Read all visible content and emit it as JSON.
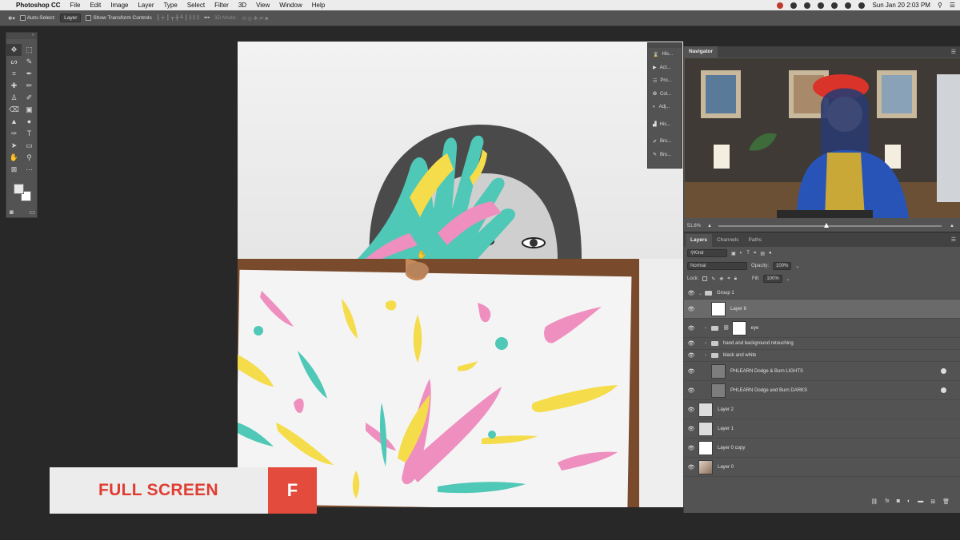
{
  "menubar": {
    "app_name": "Photoshop CC",
    "items": [
      "File",
      "Edit",
      "Image",
      "Layer",
      "Type",
      "Select",
      "Filter",
      "3D",
      "View",
      "Window",
      "Help"
    ],
    "clock": "Sun Jan 20  2:03 PM"
  },
  "options_bar": {
    "auto_select_label": "Auto-Select:",
    "auto_select_value": "Layer",
    "transform_label": "Show Transform Controls",
    "mode_3d_label": "3D Mode:"
  },
  "panel_strip": {
    "items": [
      "His...",
      "Act...",
      "Pro...",
      "Col...",
      "Adj...",
      "His...",
      "Bru...",
      "Bru..."
    ]
  },
  "navigator": {
    "tab": "Navigator",
    "zoom": "51.6%"
  },
  "layers_panel": {
    "tabs": [
      "Layers",
      "Channels",
      "Paths"
    ],
    "filter_kind": "Kind",
    "blend_mode": "Normal",
    "opacity_label": "Opacity:",
    "opacity_value": "100%",
    "lock_label": "Lock:",
    "fill_label": "Fill:",
    "fill_value": "100%",
    "layers": [
      {
        "name": "Group 1",
        "kind": "group",
        "open": true
      },
      {
        "name": "Layer 6",
        "kind": "layer",
        "selected": true
      },
      {
        "name": "eye",
        "kind": "group"
      },
      {
        "name": "hand and background retouching",
        "kind": "group"
      },
      {
        "name": "black and white",
        "kind": "group"
      },
      {
        "name": "PHLEARN Dodge & Burn LIGHTS",
        "kind": "layer"
      },
      {
        "name": "PHLEARN Dodge and Burn DARKS",
        "kind": "layer"
      },
      {
        "name": "Layer 2",
        "kind": "layer"
      },
      {
        "name": "Layer 1",
        "kind": "layer"
      },
      {
        "name": "Layer 0 copy",
        "kind": "layer"
      },
      {
        "name": "Layer 0",
        "kind": "layer"
      }
    ]
  },
  "overlay": {
    "label": "FULL SCREEN",
    "key": "F"
  },
  "colors": {
    "overlay_red": "#e34b3d",
    "paint_pink": "#ee8fbf",
    "paint_yellow": "#f4dc4a",
    "paint_teal": "#4fc8b7"
  }
}
